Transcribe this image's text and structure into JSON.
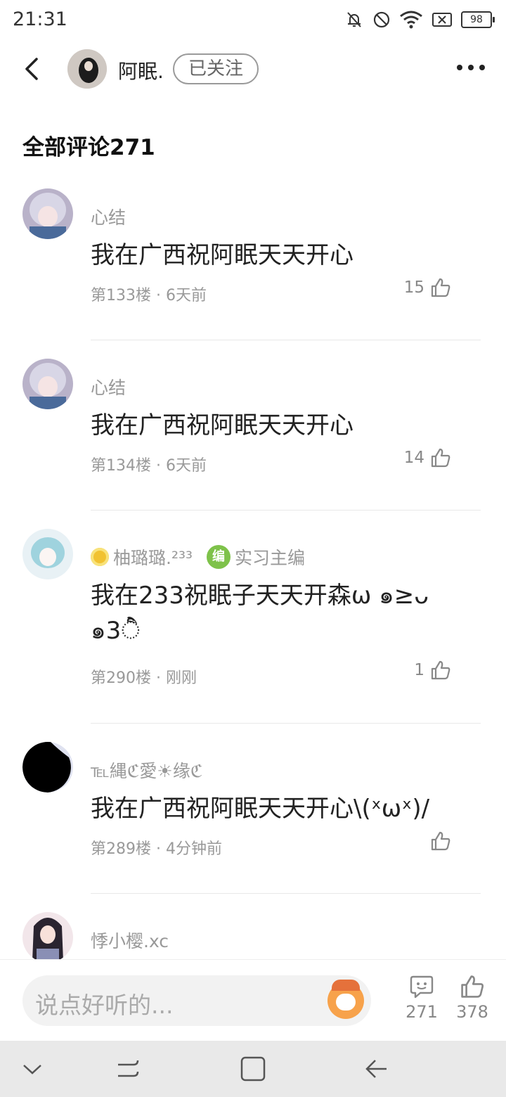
{
  "status": {
    "time": "21:31",
    "battery": "98"
  },
  "header": {
    "username": "阿眠.",
    "follow_label": "已关注"
  },
  "section_title": "全部评论271",
  "comments": [
    {
      "user": "心结",
      "text": "我在广西祝阿眠天天开心",
      "floor": "第133楼",
      "time": "6天前",
      "likes": "15"
    },
    {
      "user": "心结",
      "text": "我在广西祝阿眠天天开心",
      "floor": "第134楼",
      "time": "6天前",
      "likes": "14"
    },
    {
      "user": "柚璐璐.²³³",
      "badge": "实习主编",
      "badge_icon_text": "编",
      "text": "我在233祝眠子天天开森ω ๑≥ᴗ ๑3ੈ̑",
      "floor": "第290楼",
      "time": "刚刚",
      "likes": "1"
    },
    {
      "user": "℡縄ℭ愛☀缘ℭ",
      "text": "我在广西祝阿眠天天开心\\(ˣωˣ)/",
      "floor": "第289楼",
      "time": "4分钟前",
      "likes": ""
    },
    {
      "user": "悸小樱.xc"
    }
  ],
  "bottom_bar": {
    "placeholder": "说点好听的...",
    "comment_count": "271",
    "like_count": "378"
  },
  "icons": [
    "mute-icon",
    "dnd-icon",
    "wifi-icon",
    "battery-icon",
    "back-icon",
    "more-icon",
    "like-icon",
    "comment-icon",
    "mascot-icon",
    "nav-down-icon",
    "nav-recents-icon",
    "nav-home-icon",
    "nav-back-icon"
  ]
}
